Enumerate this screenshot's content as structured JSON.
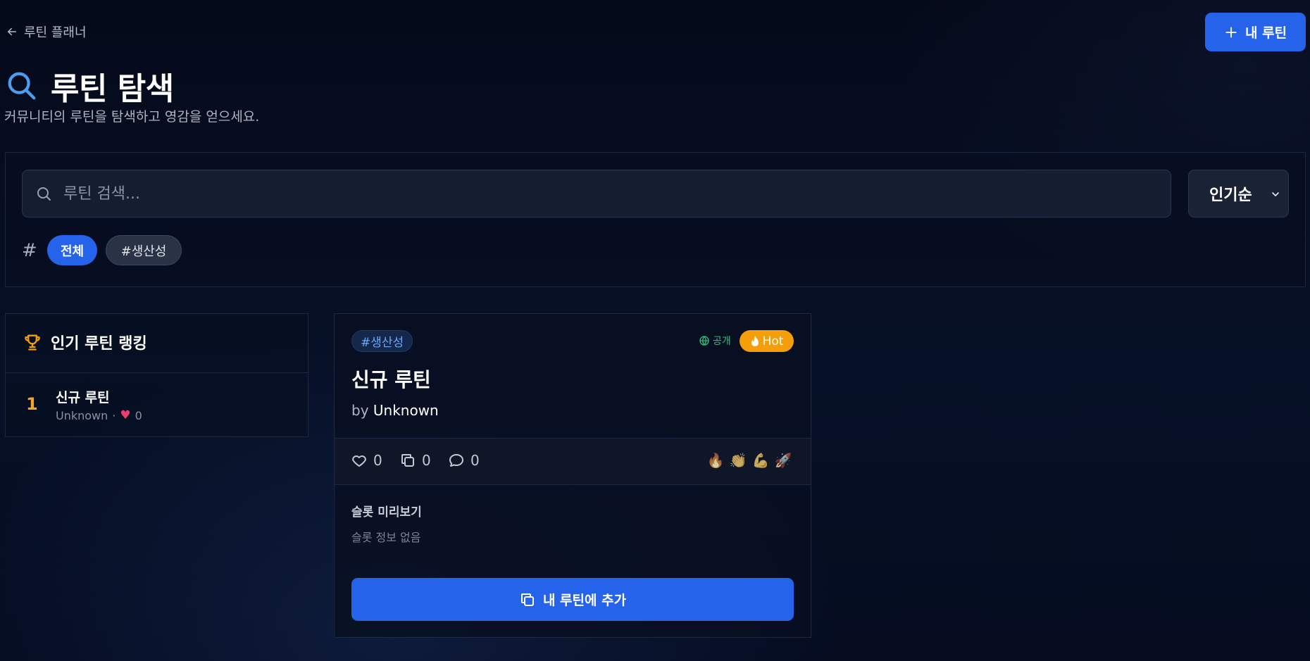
{
  "header": {
    "back_label": "루틴 플래너",
    "new_routine_label": "내 루틴",
    "title": "루틴 탐색",
    "subtitle": "커뮤니티의 루틴을 탐색하고 영감을 얻으세요."
  },
  "filters": {
    "search_placeholder": "루틴 검색...",
    "sort_selected": "인기순",
    "hash_symbol": "#",
    "tags": [
      {
        "label": "전체",
        "active": true
      },
      {
        "label": "#생산성",
        "active": false
      }
    ]
  },
  "ranking": {
    "title": "인기 루틴 랭킹",
    "items": [
      {
        "rank": "1",
        "name": "신규 루틴",
        "author": "Unknown",
        "separator": "·",
        "likes": "0"
      }
    ]
  },
  "card": {
    "tag": "#생산성",
    "visibility": "공개",
    "hot_label": "Hot",
    "title": "신규 루틴",
    "by_prefix": "by",
    "author": "Unknown",
    "likes": "0",
    "copies": "0",
    "comments": "0",
    "reactions": [
      "🔥",
      "👏",
      "💪",
      "🚀"
    ],
    "preview_label": "슬롯 미리보기",
    "preview_empty": "슬롯 정보 없음",
    "add_button_label": "내 루틴에 추가"
  },
  "colors": {
    "accent": "#2563eb",
    "hot": "#f59e0b",
    "rank_gold": "#f5a524",
    "public_green": "#2ec27e",
    "tag_blue": "#6ea6ff"
  }
}
